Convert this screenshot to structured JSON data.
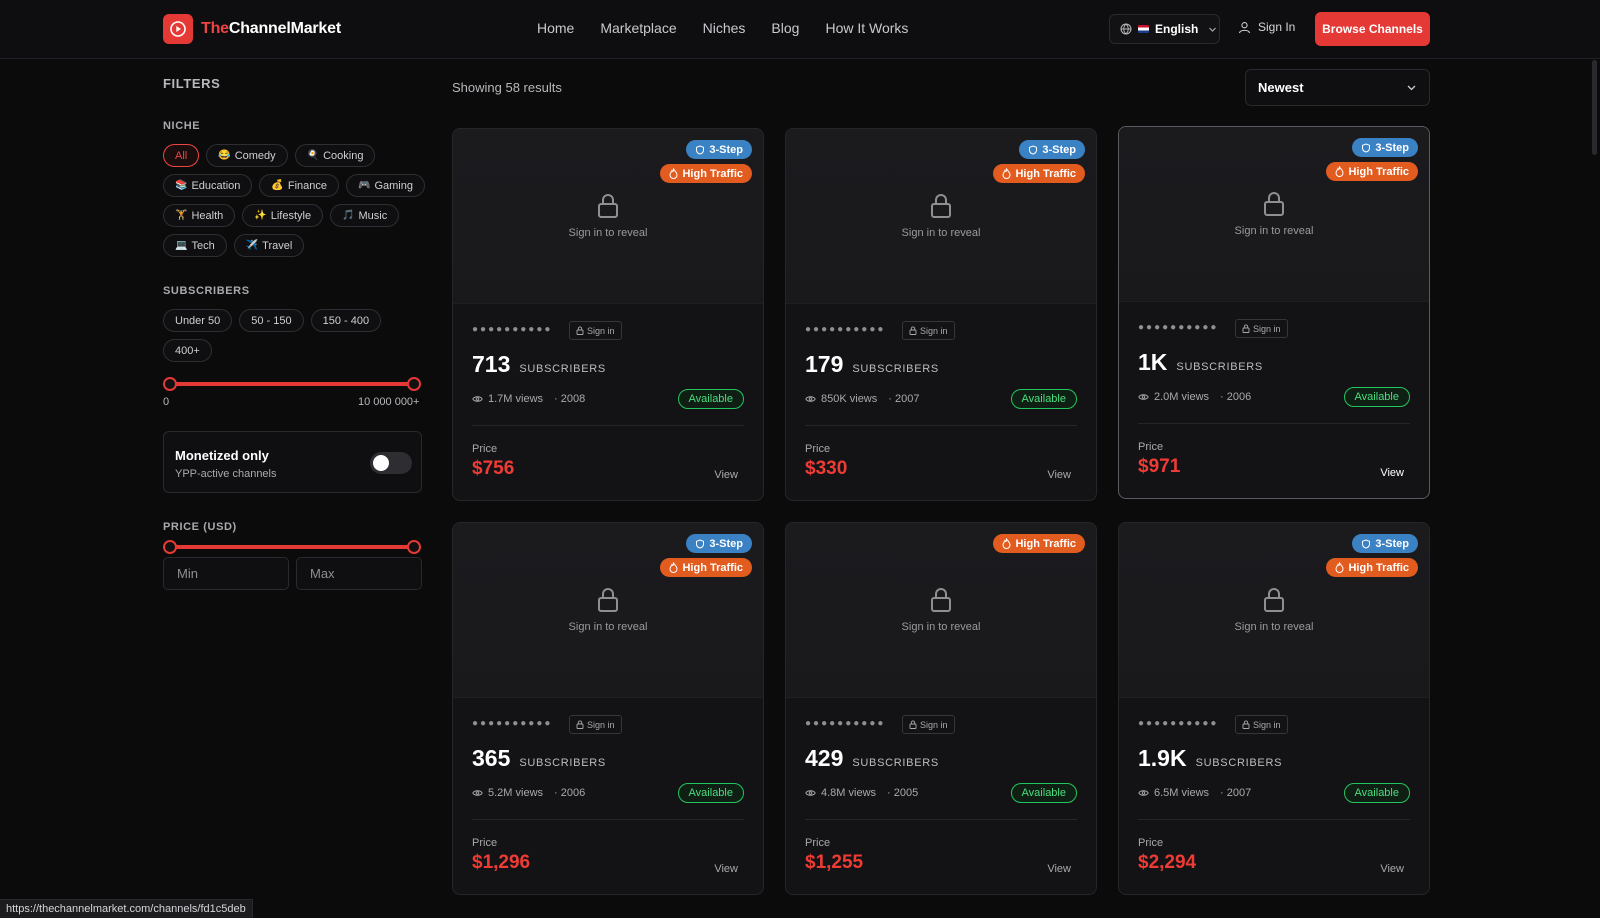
{
  "brand": {
    "part1": "The",
    "part2": "ChannelMarket"
  },
  "nav": [
    "Home",
    "Marketplace",
    "Niches",
    "Blog",
    "How It Works"
  ],
  "language": "English",
  "signin_label": "Sign In",
  "browse_label": "Browse Channels",
  "filters": {
    "title": "FILTERS",
    "niche_title": "NICHE",
    "niches": [
      {
        "label": "All",
        "emoji": ""
      },
      {
        "label": "Comedy",
        "emoji": "😂"
      },
      {
        "label": "Cooking",
        "emoji": "🍳"
      },
      {
        "label": "Education",
        "emoji": "📚"
      },
      {
        "label": "Finance",
        "emoji": "💰"
      },
      {
        "label": "Gaming",
        "emoji": "🎮"
      },
      {
        "label": "Health",
        "emoji": "🏋"
      },
      {
        "label": "Lifestyle",
        "emoji": "✨"
      },
      {
        "label": "Music",
        "emoji": "🎵"
      },
      {
        "label": "Tech",
        "emoji": "💻"
      },
      {
        "label": "Travel",
        "emoji": "✈️"
      }
    ],
    "active_niche": "All",
    "subscribers_title": "SUBSCRIBERS",
    "subscriber_ranges": [
      "Under 50",
      "50 - 150",
      "150 - 400",
      "400+"
    ],
    "sub_min_label": "0",
    "sub_max_label": "10 000 000+",
    "monetized_title": "Monetized only",
    "monetized_sub": "YPP-active channels",
    "monetized_on": false,
    "price_title": "PRICE (USD)",
    "price_min_placeholder": "Min",
    "price_max_placeholder": "Max"
  },
  "results_text": "Showing 58 results",
  "sort_value": "Newest",
  "card_text": {
    "badge_step": "3-Step",
    "badge_traffic": "High Traffic",
    "reveal": "Sign in to reveal",
    "masked_name": "●●●●●●●●●●",
    "mini_signin": "Sign in",
    "subs_label": "SUBSCRIBERS",
    "available": "Available",
    "price_label": "Price",
    "view": "View"
  },
  "cards": [
    {
      "subs": "713",
      "views": "1.7M views",
      "year": "· 2008",
      "price": "$756",
      "step": true,
      "traffic": true
    },
    {
      "subs": "179",
      "views": "850K views",
      "year": "· 2007",
      "price": "$330",
      "step": true,
      "traffic": true
    },
    {
      "subs": "1K",
      "views": "2.0M views",
      "year": "· 2006",
      "price": "$971",
      "step": true,
      "traffic": true
    },
    {
      "subs": "365",
      "views": "5.2M views",
      "year": "· 2006",
      "price": "$1,296",
      "step": true,
      "traffic": true
    },
    {
      "subs": "429",
      "views": "4.8M views",
      "year": "· 2005",
      "price": "$1,255",
      "step": false,
      "traffic": true
    },
    {
      "subs": "1.9K",
      "views": "6.5M views",
      "year": "· 2007",
      "price": "$2,294",
      "step": true,
      "traffic": true
    }
  ],
  "status_url": "https://thechannelmarket.com/channels/fd1c5deb",
  "colors": {
    "accent": "#e53935",
    "step": "#3b82c4",
    "traffic": "#e25b1f",
    "available": "#22c55e"
  }
}
